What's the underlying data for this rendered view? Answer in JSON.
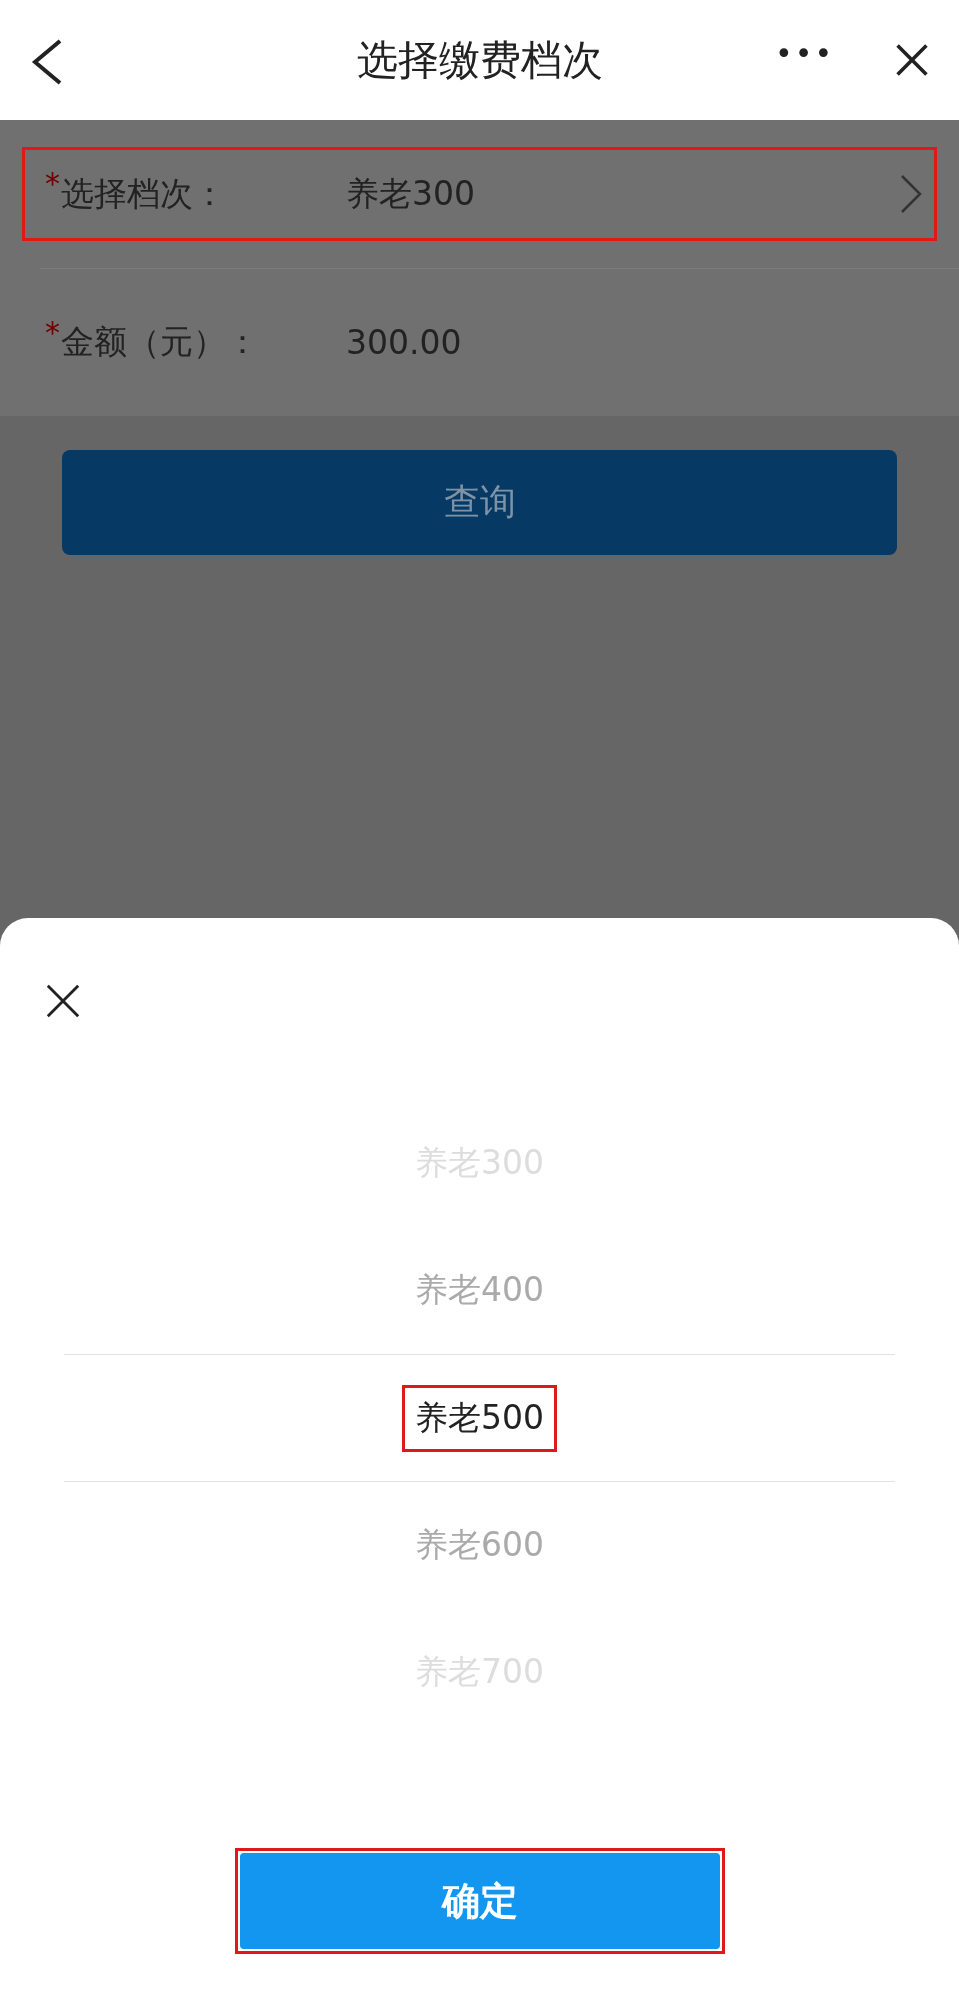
{
  "header": {
    "title": "选择缴费档次",
    "more": "•••"
  },
  "form": {
    "rows": [
      {
        "required": true,
        "mark": "*",
        "label": "选择档次：",
        "value": "养老300",
        "has_chevron": true,
        "highlighted": true
      },
      {
        "required": true,
        "mark": "*",
        "label": "金额（元）：",
        "value": "300.00",
        "has_chevron": false,
        "highlighted": false
      }
    ],
    "query_button": "查询"
  },
  "sheet": {
    "options": [
      {
        "label": "养老300",
        "selected": false,
        "highlighted": false
      },
      {
        "label": "养老400",
        "selected": false,
        "highlighted": false
      },
      {
        "label": "养老500",
        "selected": true,
        "highlighted": true
      },
      {
        "label": "养老600",
        "selected": false,
        "highlighted": false
      },
      {
        "label": "养老700",
        "selected": false,
        "highlighted": false
      }
    ],
    "confirm_button": "确定",
    "confirm_highlighted": true
  }
}
